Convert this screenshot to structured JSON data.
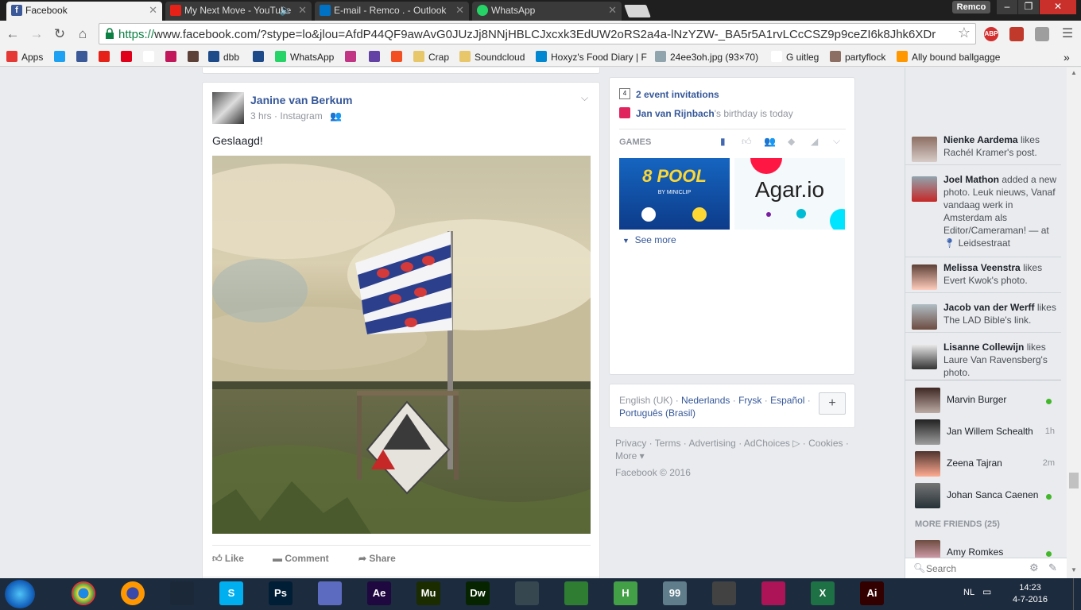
{
  "browser": {
    "tabs": [
      {
        "title": "Facebook",
        "active": true,
        "icon_color": "#3b5998"
      },
      {
        "title": "My Next Move - YouTube",
        "active": false,
        "icon_color": "#e62117"
      },
      {
        "title": "E-mail - Remco . - Outlook",
        "active": false,
        "icon_color": "#0072c6"
      },
      {
        "title": "WhatsApp",
        "active": false,
        "icon_color": "#25d366"
      }
    ],
    "window_user": "Remco",
    "url_scheme": "https://",
    "url_rest": "www.facebook.com/?stype=lo&jlou=AfdP44QF9awAvG0JUzJj8NNjHBLCJxcxk3EdUW2oRS2a4a-lNzYZW-_BA5r5A1rvLCcCSZ9p9ceZI6k8Jhk6XDr",
    "bookmarks": [
      {
        "label": "Apps",
        "icon": "apps-grid-icon",
        "color": "#e53935"
      },
      {
        "label": "",
        "icon": "twitter-icon",
        "color": "#1da1f2"
      },
      {
        "label": "",
        "icon": "facebook-icon",
        "color": "#3b5998"
      },
      {
        "label": "",
        "icon": "youtube-icon",
        "color": "#e62117"
      },
      {
        "label": "",
        "icon": "dumpert-icon",
        "color": "#e1001a"
      },
      {
        "label": "",
        "icon": "google-icon",
        "color": "#ffffff"
      },
      {
        "label": "",
        "icon": "bookmark-w-icon",
        "color": "#c2185b"
      },
      {
        "label": "",
        "icon": "bookmark-circle-icon",
        "color": "#5d4037"
      },
      {
        "label": "dbb",
        "icon": "dbb-icon",
        "color": "#1e4a8a"
      },
      {
        "label": "",
        "icon": "dbb2-icon",
        "color": "#1e4a8a"
      },
      {
        "label": "WhatsApp",
        "icon": "whatsapp-icon",
        "color": "#25d366"
      },
      {
        "label": "",
        "icon": "instagram-icon",
        "color": "#c13584"
      },
      {
        "label": "",
        "icon": "twitch-icon",
        "color": "#6441a5"
      },
      {
        "label": "",
        "icon": "microsoft-icon",
        "color": "#f25022"
      },
      {
        "label": "Crap",
        "icon": "folder-icon",
        "color": "#e8c66a"
      },
      {
        "label": "Soundcloud",
        "icon": "folder-icon",
        "color": "#e8c66a"
      },
      {
        "label": "Hoxyz's Food Diary | F",
        "icon": "x-icon",
        "color": "#0288d1"
      },
      {
        "label": "24ee3oh.jpg (93×70)",
        "icon": "image-icon",
        "color": "#90a4ae"
      },
      {
        "label": "G uitleg",
        "icon": "page-icon",
        "color": "#ffffff"
      },
      {
        "label": "partyflock",
        "icon": "partyflock-icon",
        "color": "#8d6e63"
      },
      {
        "label": "Ally bound ballgagge",
        "icon": "ph-icon",
        "color": "#ff9800"
      }
    ],
    "more_bookmarks": "»"
  },
  "post": {
    "author": "Janine van Berkum",
    "time": "3 hrs",
    "source": "Instagram",
    "text": "Geslaagd!",
    "actions": {
      "like": "Like",
      "comment": "Comment",
      "share": "Share"
    }
  },
  "right_col": {
    "events": "2 event invitations",
    "birthday_name": "Jan van Rijnbach",
    "birthday_suffix": "'s birthday is today",
    "games_heading": "GAMES",
    "games": [
      {
        "title": "8 POOL",
        "subtitle": "BY MINICLIP"
      },
      {
        "title": "Agar.io",
        "subtitle": ""
      }
    ],
    "see_more": "See more",
    "languages": {
      "current": "English (UK)",
      "others": [
        "Nederlands",
        "Frysk",
        "Español",
        "Português (Brasil)"
      ],
      "add": "+"
    },
    "footer_links": [
      "Privacy",
      "Terms",
      "Advertising",
      "AdChoices",
      "Cookies",
      "More"
    ],
    "copyright": "Facebook © 2016"
  },
  "ticker": [
    {
      "name": "Nienke Aardema",
      "text": " likes Rachél Kramer's post."
    },
    {
      "name": "Joel Mathon",
      "text": " added a new photo. Leuk nieuws, Vanaf vandaag werk in Amsterdam als Editor/Cameraman! — at",
      "place": "Leidsestraat"
    },
    {
      "name": "Melissa Veenstra",
      "text": " likes Evert Kwok's photo."
    },
    {
      "name": "Jacob van der Werff",
      "text": " likes The LAD Bible's link."
    },
    {
      "name": "Lisanne Collewijn",
      "text": " likes Laure Van Ravensberg's photo."
    }
  ],
  "chat": {
    "friends": [
      {
        "name": "Marvin Burger",
        "status": "online"
      },
      {
        "name": "Jan Willem Schealth",
        "status": "1h"
      },
      {
        "name": "Zeena Tajran",
        "status": "2m"
      },
      {
        "name": "Johan Sanca Caenen",
        "status": "online"
      }
    ],
    "more_friends": "MORE FRIENDS (25)",
    "more_list": [
      {
        "name": "Amy Romkes",
        "status": "online"
      }
    ],
    "search_placeholder": "Search"
  },
  "taskbar": {
    "apps": [
      {
        "name": "Chrome",
        "label": "",
        "color": "#4a4a4a"
      },
      {
        "name": "Firefox",
        "label": "",
        "color": "#e66000"
      },
      {
        "name": "Steam",
        "label": "",
        "color": "#1b2838"
      },
      {
        "name": "Skype",
        "label": "S",
        "color": "#00aff0"
      },
      {
        "name": "Photoshop",
        "label": "Ps",
        "color": "#001e36"
      },
      {
        "name": "Keyboard",
        "label": "",
        "color": "#5c6bc0"
      },
      {
        "name": "After Effects",
        "label": "Ae",
        "color": "#1f0740"
      },
      {
        "name": "Muse",
        "label": "Mu",
        "color": "#1a2c00"
      },
      {
        "name": "Dreamweaver",
        "label": "Dw",
        "color": "#072401"
      },
      {
        "name": "Video",
        "label": "",
        "color": "#37474f"
      },
      {
        "name": "Tool",
        "label": "",
        "color": "#2e7d32"
      },
      {
        "name": "H App",
        "label": "H",
        "color": "#43a047"
      },
      {
        "name": "Monitor",
        "label": "99",
        "color": "#607d8b"
      },
      {
        "name": "Circle",
        "label": "",
        "color": "#424242"
      },
      {
        "name": "Game",
        "label": "",
        "color": "#ad1457"
      },
      {
        "name": "Excel",
        "label": "X",
        "color": "#1e7145"
      },
      {
        "name": "Illustrator",
        "label": "Ai",
        "color": "#330000"
      }
    ],
    "lang": "NL",
    "time": "14:23",
    "date": "4-7-2016"
  }
}
